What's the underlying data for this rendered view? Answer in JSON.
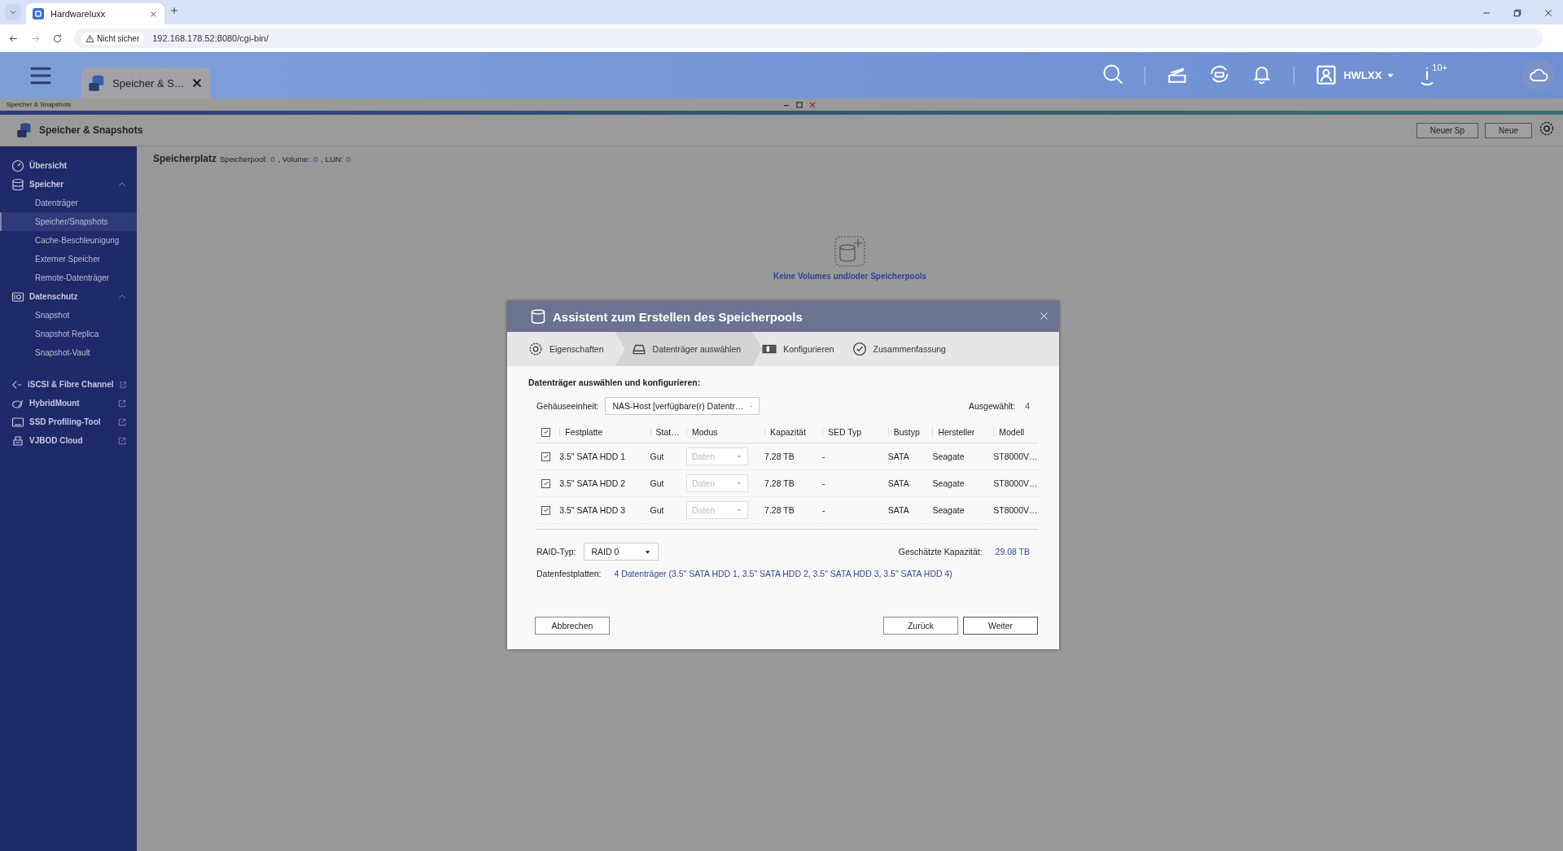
{
  "browser": {
    "tabs": [
      {
        "title": "Hardwareluxx",
        "selected": true
      }
    ],
    "security": "Nicht sicher",
    "url": "192.168.178.52:8080/cgi-bin/"
  },
  "app_header": {
    "tab": {
      "label": "Speicher & S…"
    },
    "user": "HWLXX",
    "info_badge": "10+"
  },
  "breadcrumb": "Speicher & Snapshots",
  "window": {
    "title": "Speicher & Snapshots",
    "toolbar_buttons": [
      "Neuer Sp",
      "Neue"
    ]
  },
  "sidebar": {
    "items": [
      {
        "label": "Übersicht",
        "kind": "overview",
        "selected": false
      },
      {
        "label": "Speicher",
        "kind": "storage",
        "expanded": true,
        "selected": false,
        "children": [
          {
            "label": "Datenträger",
            "selected": false
          },
          {
            "label": "Speicher/Snapshots",
            "selected": true
          },
          {
            "label": "Cache-Beschleunigung",
            "selected": false
          },
          {
            "label": "Externer Speicher",
            "selected": false
          },
          {
            "label": "Remote-Datenträger",
            "selected": false
          }
        ]
      },
      {
        "label": "Datenschutz",
        "kind": "protection",
        "expanded": true,
        "selected": false,
        "children": [
          {
            "label": "Snapshot",
            "selected": false
          },
          {
            "label": "Snapshot Replica",
            "selected": false
          },
          {
            "label": "Snapshot-Vault",
            "selected": false
          }
        ]
      },
      {
        "label": "iSCSI & Fibre Channel",
        "kind": "iscsi",
        "external": true,
        "selected": false
      },
      {
        "label": "HybridMount",
        "kind": "hybrid",
        "external": true,
        "selected": false
      },
      {
        "label": "SSD Profiling-Tool",
        "kind": "ssd",
        "external": true,
        "selected": false
      },
      {
        "label": "VJBOD Cloud",
        "kind": "vjbod",
        "external": true,
        "selected": false
      }
    ]
  },
  "summary": {
    "title": "Speicherplatz",
    "stats": [
      {
        "label": "Speicherpool:",
        "value": "0"
      },
      {
        "label": ", Volume:",
        "value": "0"
      },
      {
        "label": ", LUN:",
        "value": "0"
      }
    ]
  },
  "empty_state": "Keine Volumes und/oder Speicherpools",
  "dialog": {
    "title": "Assistent zum Erstellen des Speicherpools",
    "steps": [
      {
        "label": "Eigenschaften",
        "selected": false
      },
      {
        "label": "Datenträger auswählen",
        "selected": true
      },
      {
        "label": "Konfigurieren",
        "selected": false
      },
      {
        "label": "Zusammenfassung",
        "selected": false
      }
    ],
    "heading": "Datenträger auswählen und konfigurieren:",
    "enclosure": {
      "label": "Gehäuseeinheit:",
      "value": "NAS-Host [verfügbare(r) Datentr…"
    },
    "selected_count": {
      "label": "Ausgewählt:",
      "value": "4"
    },
    "table": {
      "all_checked": true,
      "columns": [
        "Festplatte",
        "Stat…",
        "Modus",
        "Kapazität",
        "SED Typ",
        "Bustyp",
        "Hersteller",
        "Modell"
      ],
      "rows": [
        {
          "checked": true,
          "disk": "3.5\" SATA HDD 1",
          "status": "Gut",
          "mode": "Daten",
          "mode_disabled": true,
          "capacity": "7.28 TB",
          "sed": "-",
          "bus": "SATA",
          "vendor": "Seagate",
          "model": "ST8000V…"
        },
        {
          "checked": true,
          "disk": "3.5\" SATA HDD 2",
          "status": "Gut",
          "mode": "Daten",
          "mode_disabled": true,
          "capacity": "7.28 TB",
          "sed": "-",
          "bus": "SATA",
          "vendor": "Seagate",
          "model": "ST8000V…"
        },
        {
          "checked": true,
          "disk": "3.5\" SATA HDD 3",
          "status": "Gut",
          "mode": "Daten",
          "mode_disabled": true,
          "capacity": "7.28 TB",
          "sed": "-",
          "bus": "SATA",
          "vendor": "Seagate",
          "model": "ST8000V…"
        }
      ]
    },
    "raid": {
      "label": "RAID-Typ:",
      "value": "RAID 0"
    },
    "capacity": {
      "label": "Geschätzte Kapazität:",
      "value": "29.08 TB"
    },
    "disks": {
      "label": "Datenfestplatten:",
      "value": "4 Datenträger (3.5\" SATA HDD 1, 3.5\" SATA HDD 2, 3.5\" SATA HDD 3, 3.5\" SATA HDD 4)"
    },
    "buttons": {
      "cancel": "Abbrechen",
      "back": "Zurück",
      "next": "Weiter"
    }
  }
}
